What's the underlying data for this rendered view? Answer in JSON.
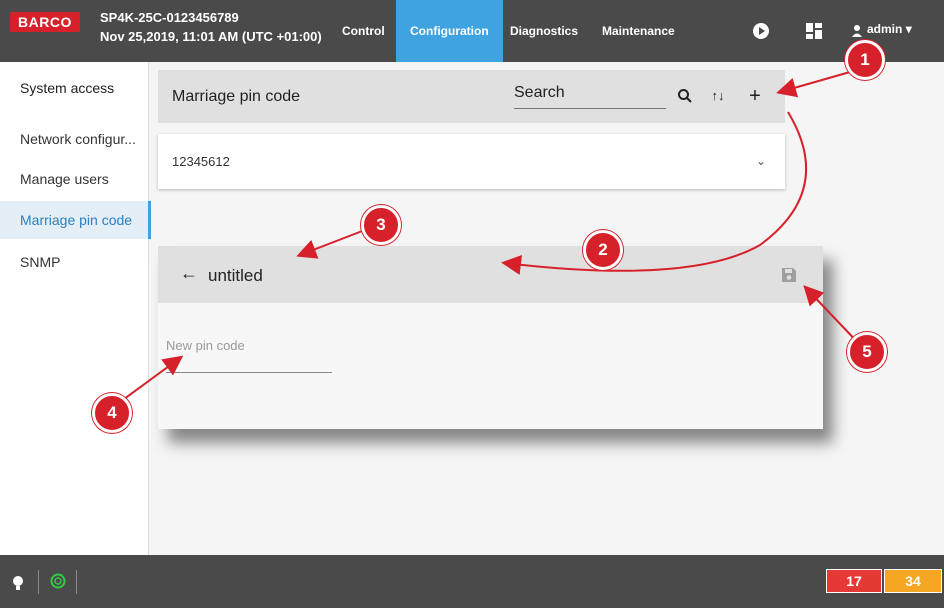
{
  "header": {
    "logo": "BARCO",
    "device_name": "SP4K-25C-0123456789",
    "datetime": "Nov 25,2019, 11:01 AM (UTC +01:00)",
    "tabs": [
      {
        "label": "Control"
      },
      {
        "label": "Configuration",
        "active": true
      },
      {
        "label": "Diagnostics"
      },
      {
        "label": "Maintenance"
      }
    ],
    "user": "admin",
    "icons": [
      "play-icon",
      "layout-icon",
      "user-icon",
      "caret-down-icon"
    ]
  },
  "sidebar": {
    "title": "System access",
    "items": [
      {
        "label": "Network configur..."
      },
      {
        "label": "Manage users"
      },
      {
        "label": "Marriage pin code",
        "active": true
      },
      {
        "label": "SNMP"
      }
    ]
  },
  "panel": {
    "title": "Marriage pin code",
    "search_placeholder": "Search",
    "icons": [
      "search-icon",
      "sort-icon",
      "add-icon"
    ],
    "rows": [
      {
        "value": "12345612"
      }
    ]
  },
  "dialog": {
    "title": "untitled",
    "field_placeholder": "New pin code",
    "icons": [
      "back-arrow-icon",
      "save-icon"
    ]
  },
  "footer": {
    "badges": [
      {
        "value": "17",
        "color": "#e53935"
      },
      {
        "value": "34",
        "color": "#f5a623"
      }
    ],
    "icons": [
      "bulb-icon",
      "status-ring-icon"
    ]
  },
  "callouts": [
    "1",
    "2",
    "3",
    "4",
    "5"
  ],
  "colors": {
    "accent": "#3fa3e0",
    "brand": "#d6212b",
    "bar": "#4a4a4a"
  }
}
